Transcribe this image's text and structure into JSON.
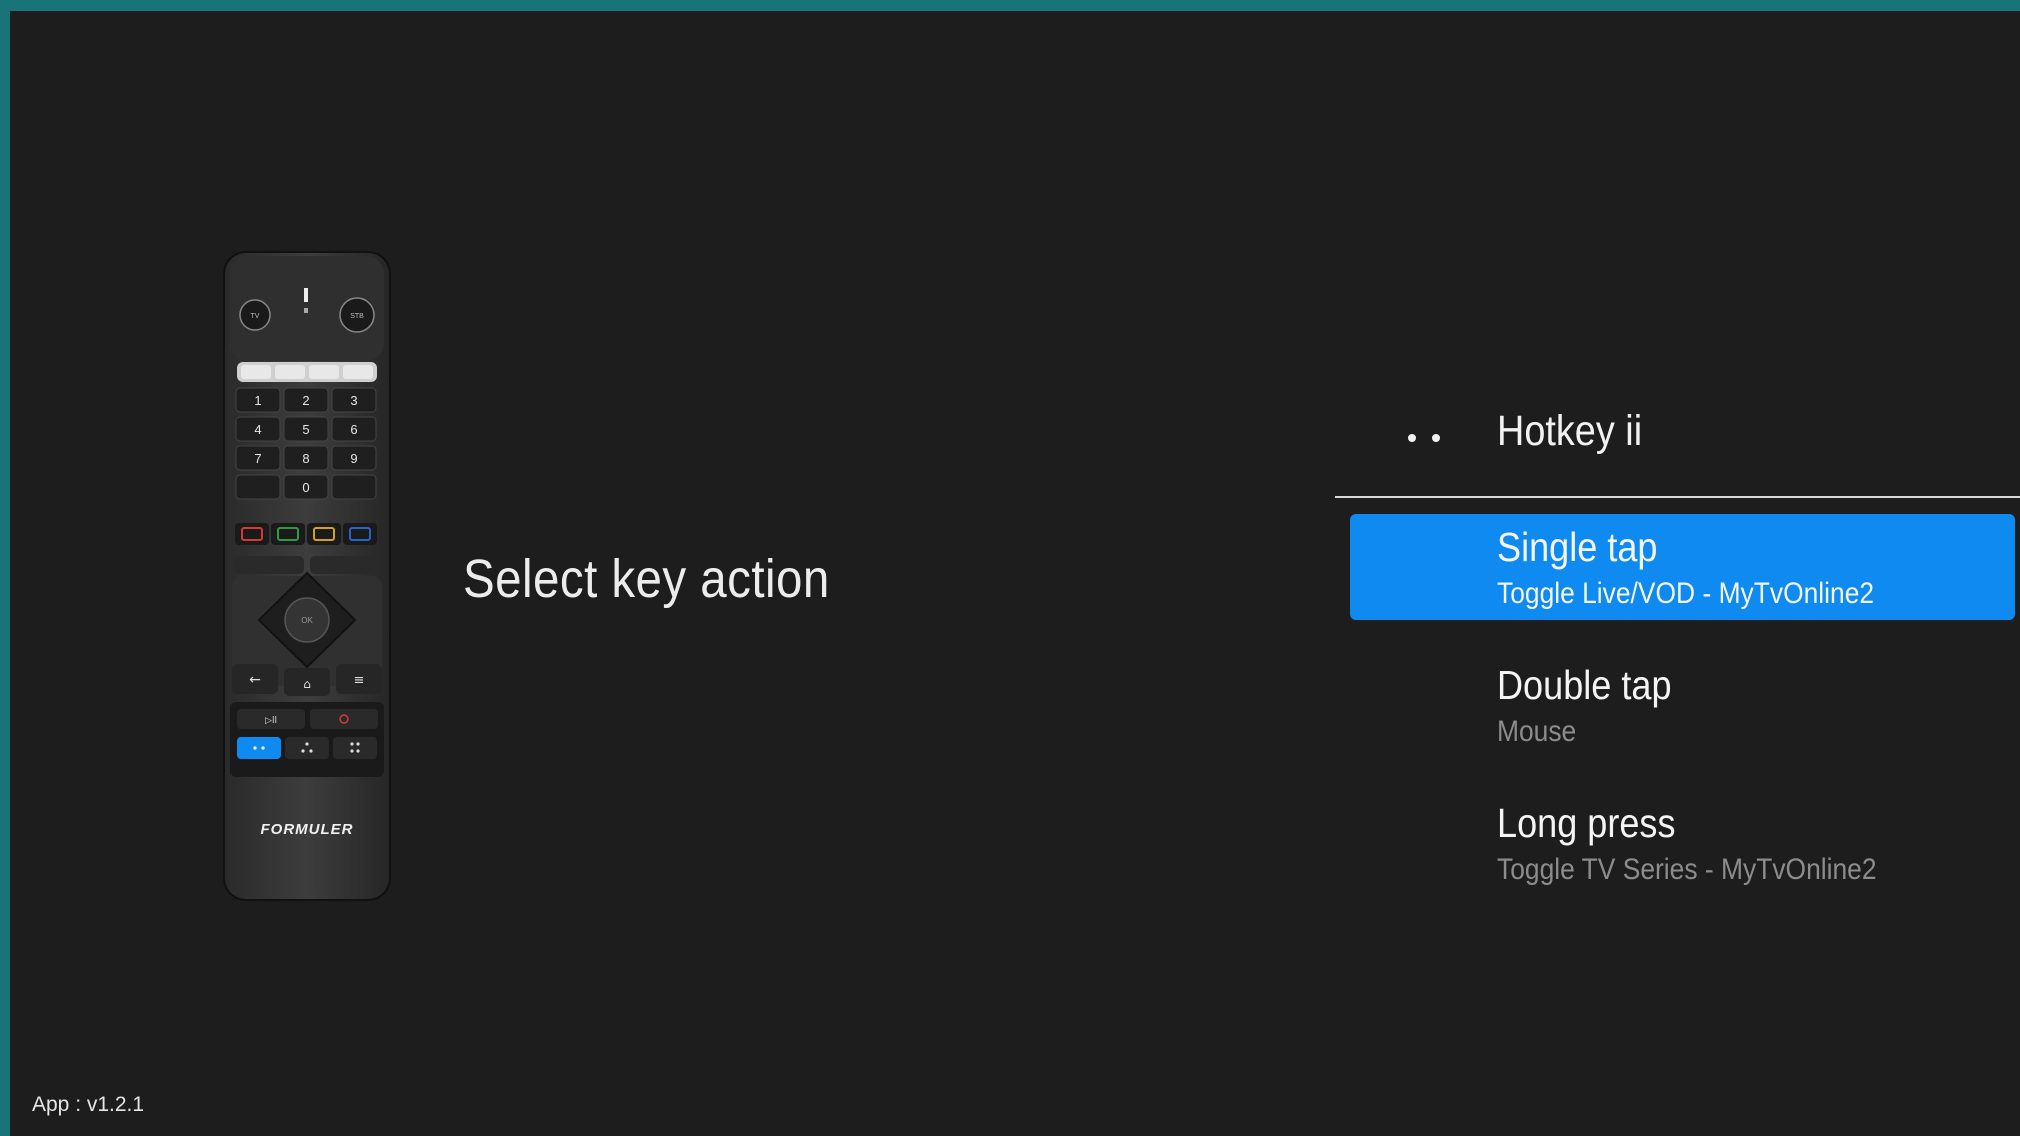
{
  "prompt": "Select key action",
  "hotkey": {
    "icon": "two-dots-icon",
    "title": "Hotkey ii"
  },
  "options": [
    {
      "label": "Single tap",
      "value": "Toggle Live/VOD - MyTvOnline2",
      "selected": true
    },
    {
      "label": "Double tap",
      "value": "Mouse",
      "selected": false
    },
    {
      "label": "Long press",
      "value": "Toggle TV Series - MyTvOnline2",
      "selected": false
    }
  ],
  "remote": {
    "brand": "FORMULER",
    "top_left_button": "TV",
    "top_right_button": "STB",
    "keypad": [
      "1",
      "2",
      "3",
      "4",
      "5",
      "6",
      "7",
      "8",
      "9",
      "0"
    ],
    "highlighted_key": "hotkey-ii",
    "colors": {
      "highlight": "#0f8af0",
      "red": "#d23b34",
      "green": "#2e9a47",
      "yellow": "#d4a11c",
      "blue": "#2a62c9"
    }
  },
  "footer": {
    "version": "App : v1.2.1"
  },
  "colors": {
    "background": "#1d1d1d",
    "frame": "#197478",
    "accent": "#0f8af0"
  }
}
